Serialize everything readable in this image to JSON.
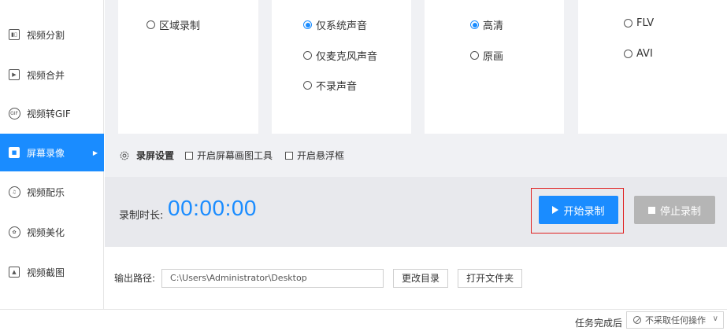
{
  "sidebar": {
    "items": [
      {
        "label": "视频分割",
        "icon": "video-split-icon"
      },
      {
        "label": "视频合并",
        "icon": "video-merge-icon"
      },
      {
        "label": "视频转GIF",
        "icon": "gif-icon"
      },
      {
        "label": "屏幕录像",
        "icon": "screen-record-icon",
        "active": true
      },
      {
        "label": "视频配乐",
        "icon": "music-icon"
      },
      {
        "label": "视频美化",
        "icon": "beautify-icon"
      },
      {
        "label": "视频截图",
        "icon": "screenshot-icon"
      }
    ]
  },
  "options": {
    "region": {
      "label": "区域录制"
    },
    "audio": [
      {
        "label": "仅系统声音",
        "selected": true
      },
      {
        "label": "仅麦克风声音",
        "selected": false
      },
      {
        "label": "不录声音",
        "selected": false
      }
    ],
    "quality": [
      {
        "label": "高清",
        "selected": true
      },
      {
        "label": "原画",
        "selected": false
      }
    ],
    "format": [
      {
        "label": "FLV",
        "selected": false
      },
      {
        "label": "AVI",
        "selected": false
      }
    ]
  },
  "settings": {
    "title": "录屏设置",
    "draw_tool_label": "开启屏幕画图工具",
    "floating_label": "开启悬浮框"
  },
  "record": {
    "duration_label": "录制时长:",
    "duration_value": "00:00:00",
    "start_label": "开始录制",
    "stop_label": "停止录制"
  },
  "output": {
    "label": "输出路径:",
    "path": "C:\\Users\\Administrator\\Desktop",
    "change_dir_label": "更改目录",
    "open_folder_label": "打开文件夹"
  },
  "footer": {
    "after_task_label": "任务完成后",
    "after_task_value": "不采取任何操作"
  },
  "colors": {
    "accent": "#1a8cff",
    "highlight": "#e02020",
    "disabled": "#b5b5b5"
  }
}
